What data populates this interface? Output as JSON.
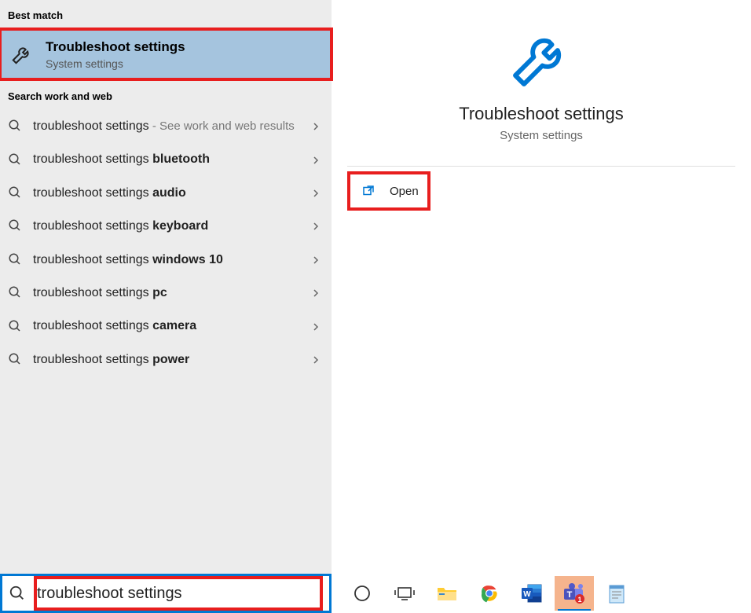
{
  "left": {
    "best_match_header": "Best match",
    "best_item": {
      "title": "Troubleshoot settings",
      "subtitle": "System settings"
    },
    "search_header": "Search work and web",
    "suggestions": [
      {
        "prefix": "troubleshoot settings",
        "bold": "",
        "suffix": " - See work and web results"
      },
      {
        "prefix": "troubleshoot settings ",
        "bold": "bluetooth",
        "suffix": ""
      },
      {
        "prefix": "troubleshoot settings ",
        "bold": "audio",
        "suffix": ""
      },
      {
        "prefix": "troubleshoot settings ",
        "bold": "keyboard",
        "suffix": ""
      },
      {
        "prefix": "troubleshoot settings ",
        "bold": "windows 10",
        "suffix": ""
      },
      {
        "prefix": "troubleshoot settings ",
        "bold": "pc",
        "suffix": ""
      },
      {
        "prefix": "troubleshoot settings ",
        "bold": "camera",
        "suffix": ""
      },
      {
        "prefix": "troubleshoot settings ",
        "bold": "power",
        "suffix": ""
      }
    ]
  },
  "right": {
    "title": "Troubleshoot settings",
    "subtitle": "System settings",
    "actions": {
      "open_label": "Open"
    }
  },
  "taskbar": {
    "search_value": "troubleshoot settings",
    "icons": [
      {
        "name": "cortana-icon",
        "active": false
      },
      {
        "name": "task-view-icon",
        "active": false
      },
      {
        "name": "file-explorer-icon",
        "active": false
      },
      {
        "name": "chrome-icon",
        "active": false
      },
      {
        "name": "word-icon",
        "active": false
      },
      {
        "name": "teams-icon",
        "active": true
      },
      {
        "name": "notepad-icon",
        "active": false
      }
    ]
  },
  "colors": {
    "accent": "#0078d4",
    "highlight": "#e81e1e",
    "selected": "#a5c4de"
  }
}
